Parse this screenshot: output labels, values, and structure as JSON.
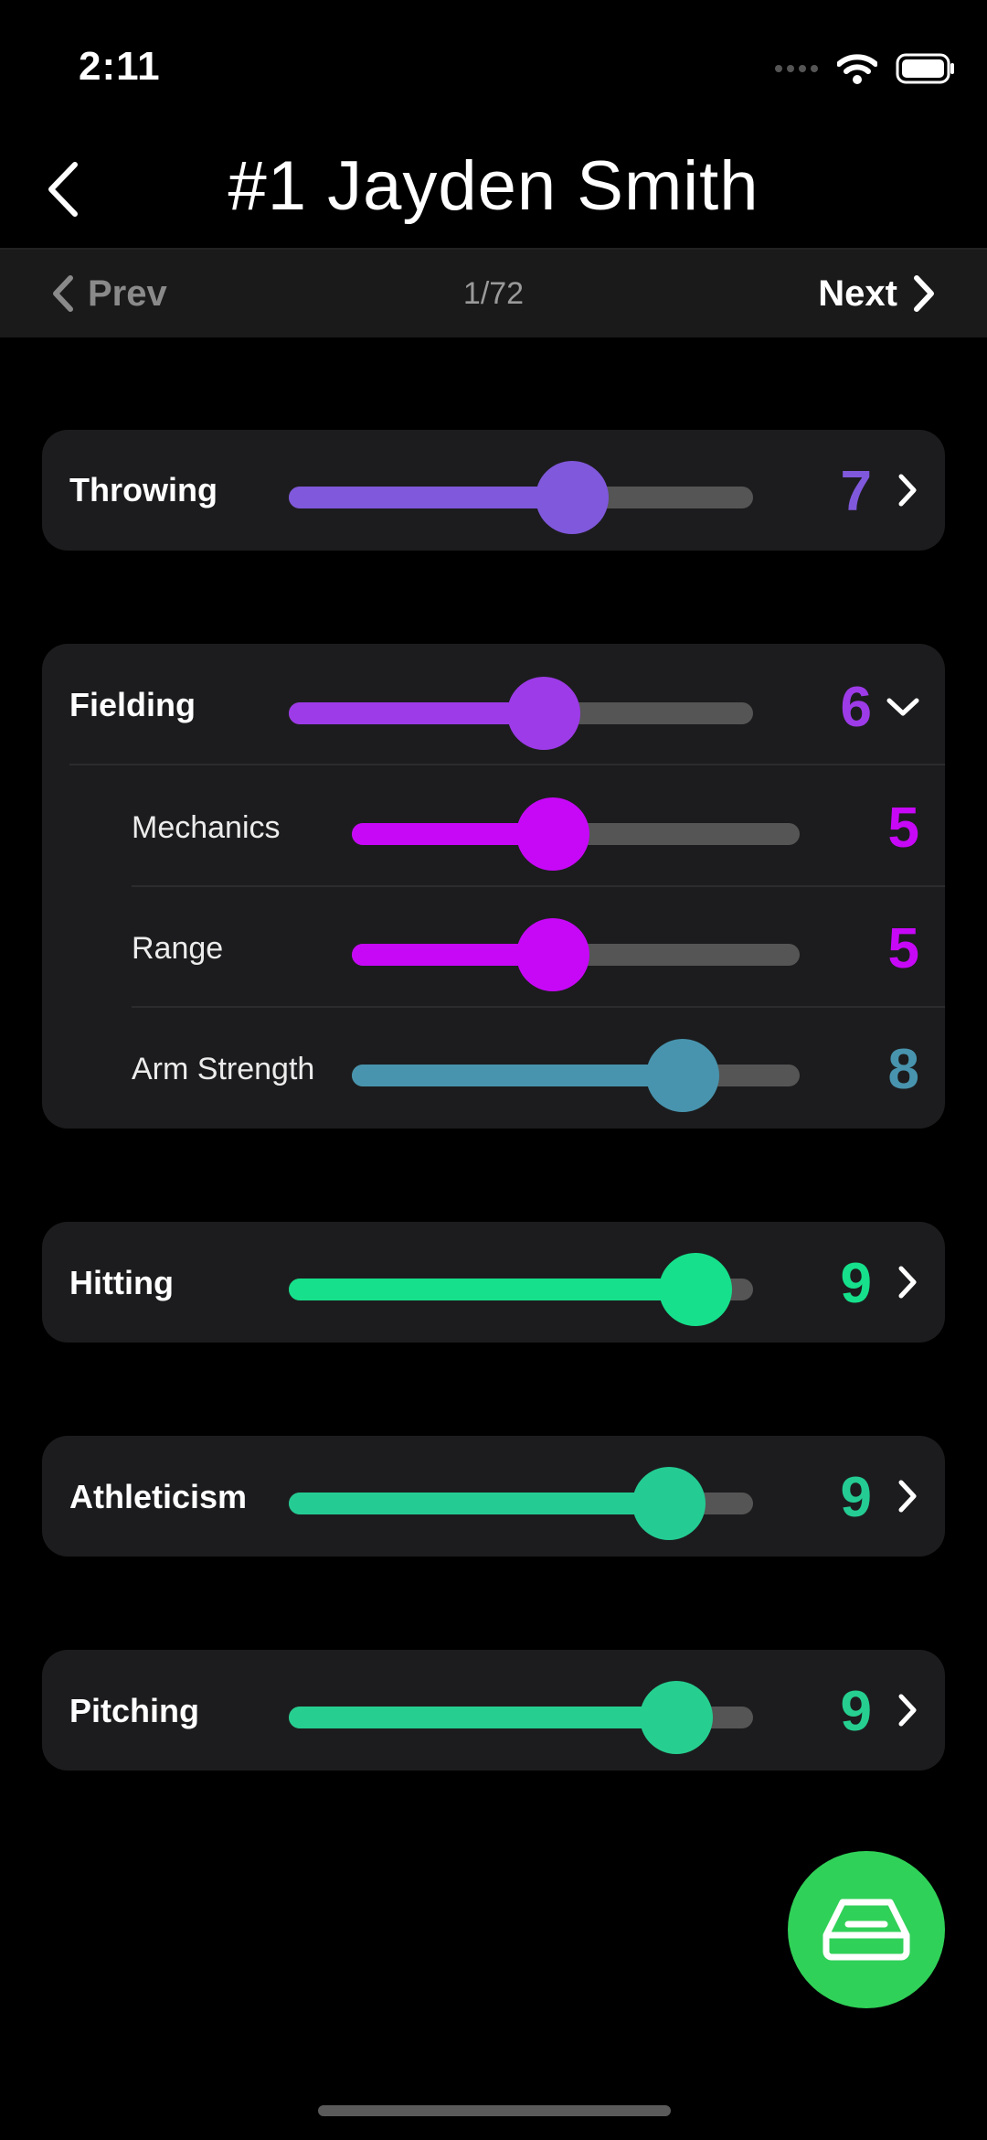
{
  "status_bar": {
    "time": "2:11"
  },
  "header": {
    "title": "#1 Jayden Smith"
  },
  "pager": {
    "prev_label": "Prev",
    "count": "1/72",
    "next_label": "Next"
  },
  "ratings": {
    "throwing": {
      "label": "Throwing",
      "value": "7",
      "color": "#8058dc"
    },
    "fielding": {
      "label": "Fielding",
      "value": "6",
      "color": "#9d3be8",
      "subs": [
        {
          "label": "Mechanics",
          "value": "5",
          "color": "#c708f7"
        },
        {
          "label": "Range",
          "value": "5",
          "color": "#c708f7"
        },
        {
          "label": "Arm Strength",
          "value": "8",
          "color": "#4894ae"
        }
      ]
    },
    "hitting": {
      "label": "Hitting",
      "value": "9",
      "color": "#16e08b"
    },
    "athleticism": {
      "label": "Athleticism",
      "value": "9",
      "color": "#24cc93"
    },
    "pitching": {
      "label": "Pitching",
      "value": "9",
      "color": "#26cf90"
    }
  },
  "icons": {
    "back": "chevron-left-icon",
    "prev": "chevron-left-icon",
    "next": "chevron-right-icon",
    "expand": "chevron-right-icon",
    "collapse": "chevron-down-icon",
    "fab": "save-tray-icon",
    "wifi": "wifi-icon",
    "battery": "battery-icon",
    "signal": "signal-icon"
  },
  "fab_color": "#30d158"
}
